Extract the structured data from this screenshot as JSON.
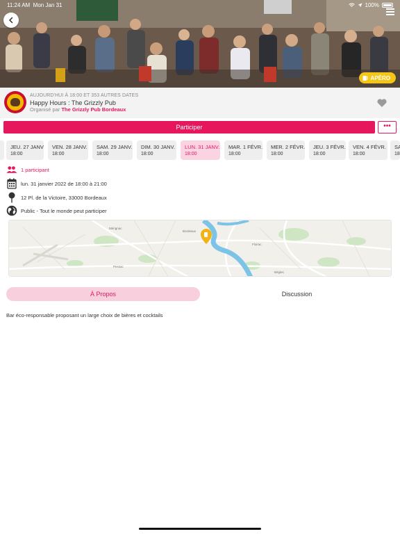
{
  "status_bar": {
    "time": "11:24 AM",
    "date": "Mon Jan 31",
    "battery": "100%"
  },
  "hero": {
    "badge_label": "APÉRO",
    "badge_color": "#f5c518"
  },
  "event": {
    "date_summary": "AUJOURD'HUI À 18:00 ET 353 AUTRES DATES",
    "title": "Happy Hours : The Grizzly Pub",
    "organizer_prefix": "Organisé par",
    "organizer_name": "The Grizzly Pub Bordeaux"
  },
  "actions": {
    "participate_label": "Participer",
    "more_label": "•••"
  },
  "dates": [
    {
      "day": "JEU. 27 JANV.",
      "time": "18:00",
      "active": false
    },
    {
      "day": "VEN. 28 JANV.",
      "time": "18:00",
      "active": false
    },
    {
      "day": "SAM. 29 JANV.",
      "time": "18:00",
      "active": false
    },
    {
      "day": "DIM. 30 JANV.",
      "time": "18:00",
      "active": false
    },
    {
      "day": "LUN. 31 JANV.",
      "time": "18:00",
      "active": true
    },
    {
      "day": "MAR. 1 FÉVR.",
      "time": "18:00",
      "active": false
    },
    {
      "day": "MER. 2 FÉVR.",
      "time": "18:00",
      "active": false
    },
    {
      "day": "JEU. 3 FÉVR.",
      "time": "18:00",
      "active": false
    },
    {
      "day": "VEN. 4 FÉVR.",
      "time": "18:00",
      "active": false
    },
    {
      "day": "SA",
      "time": "18",
      "active": false
    }
  ],
  "details": {
    "participants": "1 participant",
    "datetime": "lun. 31 janvier 2022 de 18:00 à 21:00",
    "address": "12 Pl. de la Victoire, 33000 Bordeaux",
    "visibility": "Public - Tout le monde peut participer"
  },
  "map": {
    "labels": [
      "Bordeaux",
      "Mérignac",
      "Floirac",
      "Pessac",
      "Bègles"
    ]
  },
  "tabs": {
    "about": "À Propos",
    "discussion": "Discussion"
  },
  "description": "Bar éco-responsable proposant un large choix de bières et cocktails",
  "colors": {
    "accent": "#e6175c",
    "accent_soft": "#fad4e2"
  }
}
